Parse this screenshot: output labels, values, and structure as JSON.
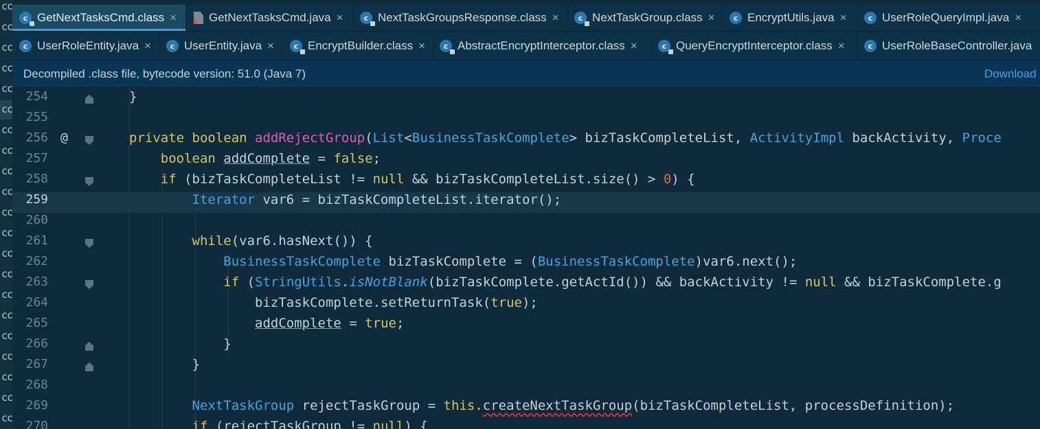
{
  "left_strip": {
    "fragment": "cc"
  },
  "tabs_row1": [
    {
      "label": "GetNextTasksCmd.class",
      "icon": "class-lock-icon",
      "active": true
    },
    {
      "label": "GetNextTasksCmd.java",
      "icon": "java-file-icon"
    },
    {
      "label": "NextTaskGroupsResponse.class",
      "icon": "class-lock-icon"
    },
    {
      "label": "NextTaskGroup.class",
      "icon": "class-lock-icon"
    },
    {
      "label": "EncryptUtils.java",
      "icon": "class-icon"
    },
    {
      "label": "UserRoleQueryImpl.java",
      "icon": "class-icon"
    }
  ],
  "tabs_row2": [
    {
      "label": "UserRoleEntity.java",
      "icon": "class-icon"
    },
    {
      "label": "UserEntity.java",
      "icon": "class-icon"
    },
    {
      "label": "EncryptBuilder.class",
      "icon": "class-lock-icon"
    },
    {
      "label": "AbstractEncryptInterceptor.class",
      "icon": "abstract-class-lock-icon"
    },
    {
      "label": "QueryEncryptInterceptor.class",
      "icon": "class-lock-icon"
    },
    {
      "label": "UserRoleBaseController.java",
      "icon": "class-icon"
    }
  ],
  "close_glyph": "×",
  "banner": {
    "text": "Decompiled .class file, bytecode version: 51.0 (Java 7)",
    "link": "Download"
  },
  "editor": {
    "current_line": "259",
    "lines": [
      {
        "num": "254"
      },
      {
        "num": "255"
      },
      {
        "num": "256",
        "annotation": "@"
      },
      {
        "num": "257"
      },
      {
        "num": "258"
      },
      {
        "num": "259"
      },
      {
        "num": "260"
      },
      {
        "num": "261"
      },
      {
        "num": "262"
      },
      {
        "num": "263"
      },
      {
        "num": "264"
      },
      {
        "num": "265"
      },
      {
        "num": "266"
      },
      {
        "num": "267"
      },
      {
        "num": "268"
      },
      {
        "num": "269"
      },
      {
        "num": "270"
      }
    ]
  },
  "colors": {
    "background": "#0f2a3a",
    "keyword": "#d6c65c",
    "type": "#3fa6e6",
    "method_decl": "#e35bb3",
    "number": "#e06c3b",
    "error_underline": "#e0303a",
    "link": "#4a9ee4"
  }
}
